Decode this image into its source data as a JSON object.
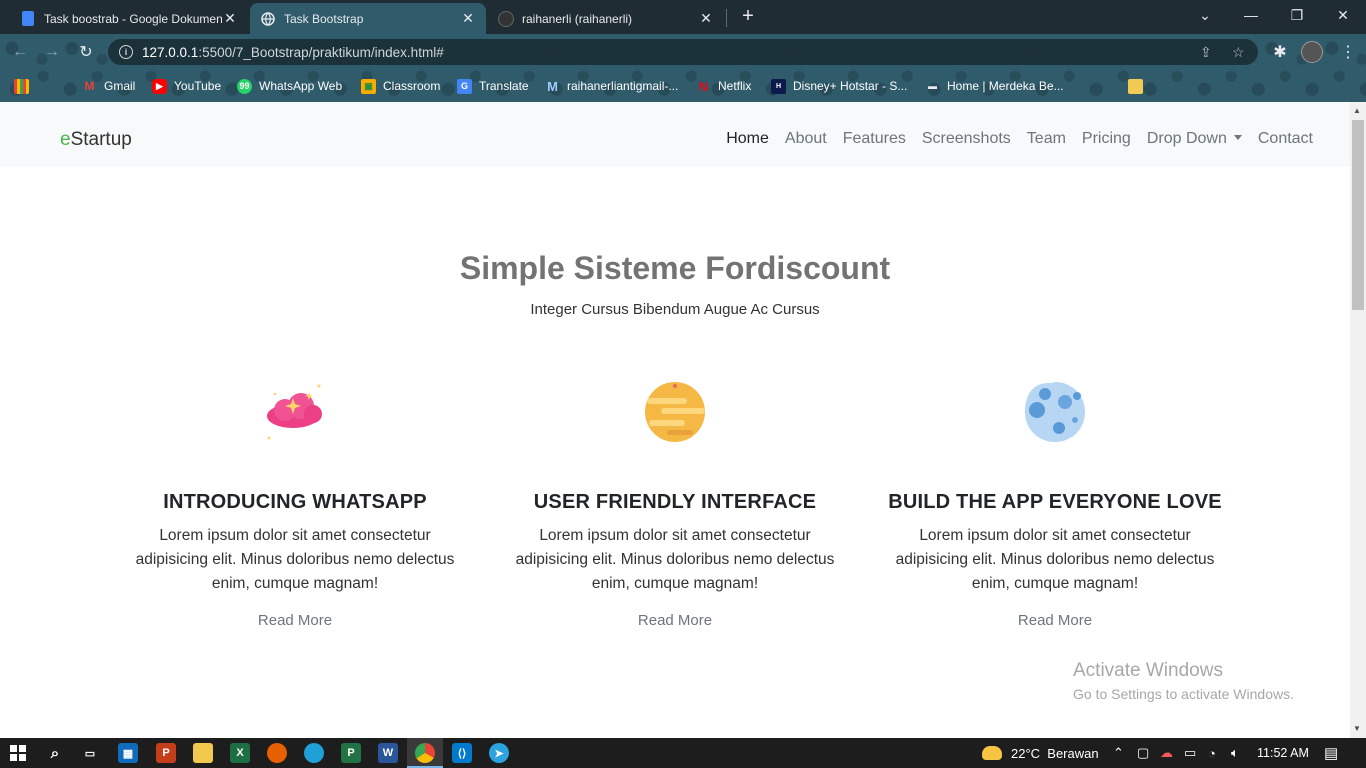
{
  "browser": {
    "tabs": [
      {
        "title": "Task boostrab - Google Dokumen",
        "active": false
      },
      {
        "title": "Task Bootstrap",
        "active": true
      },
      {
        "title": "raihanerli (raihanerli)",
        "active": false
      }
    ],
    "url": {
      "host": "127.0.0.1",
      "path": ":5500/7_Bootstrap/praktikum/index.html#"
    },
    "bookmarks": [
      "Gmail",
      "YouTube",
      "WhatsApp Web",
      "Classroom",
      "Translate",
      "raihanerliantigmail-...",
      "Netflix",
      "Disney+ Hotstar - S...",
      "Home | Merdeka Be..."
    ]
  },
  "site": {
    "brand": {
      "prefix": "e",
      "rest": "Startup"
    },
    "nav": [
      "Home",
      "About",
      "Features",
      "Screenshots",
      "Team",
      "Pricing",
      "Drop Down",
      "Contact"
    ],
    "hero": {
      "title": "Simple Sisteme Fordiscount",
      "subtitle": "Integer Cursus Bibendum Augue Ac Cursus"
    },
    "features": [
      {
        "title": "INTRODUCING WHATSAPP",
        "text": "Lorem ipsum dolor sit amet consectetur adipisicing elit. Minus doloribus nemo delectus enim, cumque magnam!",
        "link": "Read More",
        "icon": "pink-cloud-icon"
      },
      {
        "title": "USER FRIENDLY INTERFACE",
        "text": "Lorem ipsum dolor sit amet consectetur adipisicing elit. Minus doloribus nemo delectus enim, cumque magnam!",
        "link": "Read More",
        "icon": "yellow-planet-icon"
      },
      {
        "title": "BUILD THE APP EVERYONE LOVE",
        "text": "Lorem ipsum dolor sit amet consectetur adipisicing elit. Minus doloribus nemo delectus enim, cumque magnam!",
        "link": "Read More",
        "icon": "blue-moon-icon"
      }
    ]
  },
  "watermark": {
    "line1": "Activate Windows",
    "line2": "Go to Settings to activate Windows."
  },
  "taskbar": {
    "weather": "22°C  Berawan",
    "time": "11:52 AM"
  },
  "colors": {
    "brand_accent": "#49b749",
    "chrome_tab": "#2f5b6b",
    "taskbar": "#1d1d1d"
  }
}
